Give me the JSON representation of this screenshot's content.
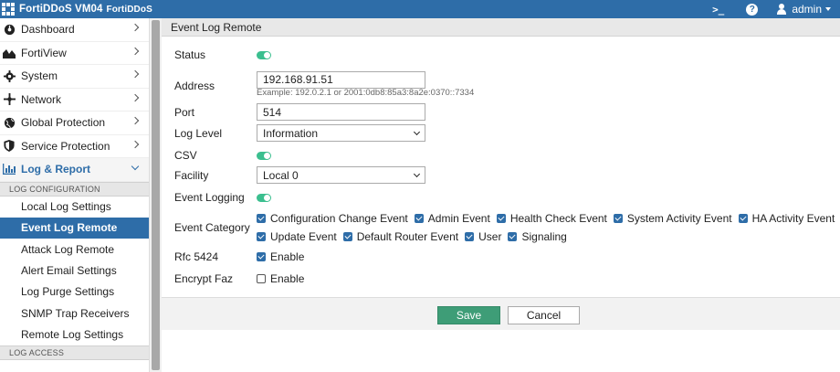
{
  "app": {
    "title": "FortiDDoS VM04",
    "subtitle": "FortiDDoS"
  },
  "topbar": {
    "terminal_label": ">_",
    "help_label": "?",
    "user_label": "admin"
  },
  "sidebar": {
    "items": [
      {
        "label": "Dashboard",
        "icon": "dashboard-icon"
      },
      {
        "label": "FortiView",
        "icon": "fortiview-icon"
      },
      {
        "label": "System",
        "icon": "gear-icon"
      },
      {
        "label": "Network",
        "icon": "network-icon"
      },
      {
        "label": "Global Protection",
        "icon": "globe-icon"
      },
      {
        "label": "Service Protection",
        "icon": "shield-icon"
      },
      {
        "label": "Log & Report",
        "icon": "bar-chart-icon"
      }
    ],
    "section_log_config": "LOG CONFIGURATION",
    "sub_items": [
      {
        "label": "Local Log Settings"
      },
      {
        "label": "Event Log Remote"
      },
      {
        "label": "Attack Log Remote"
      },
      {
        "label": "Alert Email Settings"
      },
      {
        "label": "Log Purge Settings"
      },
      {
        "label": "SNMP Trap Receivers"
      },
      {
        "label": "Remote Log Settings"
      }
    ],
    "section_log_access": "LOG ACCESS"
  },
  "panel": {
    "title": "Event Log Remote",
    "status_label": "Status",
    "address_label": "Address",
    "address_value": "192.168.91.51",
    "address_hint": "Example: 192.0.2.1 or 2001:0db8:85a3:8a2e:0370::7334",
    "port_label": "Port",
    "port_value": "514",
    "log_level_label": "Log Level",
    "log_level_value": "Information",
    "csv_label": "CSV",
    "facility_label": "Facility",
    "facility_value": "Local 0",
    "event_logging_label": "Event Logging",
    "event_category_label": "Event Category",
    "categories_line1": [
      "Configuration Change Event",
      "Admin Event",
      "Health Check Event",
      "System Activity Event",
      "HA Activity Event"
    ],
    "categories_line2": [
      "Update Event",
      "Default Router Event",
      "User",
      "Signaling"
    ],
    "rfc_label": "Rfc 5424",
    "rfc_option": "Enable",
    "encrypt_label": "Encrypt Faz",
    "encrypt_option": "Enable"
  },
  "buttons": {
    "save": "Save",
    "cancel": "Cancel"
  },
  "colors": {
    "brand": "#2e6da8",
    "toggle_on": "#3bbf8f",
    "save": "#3e9d77"
  }
}
